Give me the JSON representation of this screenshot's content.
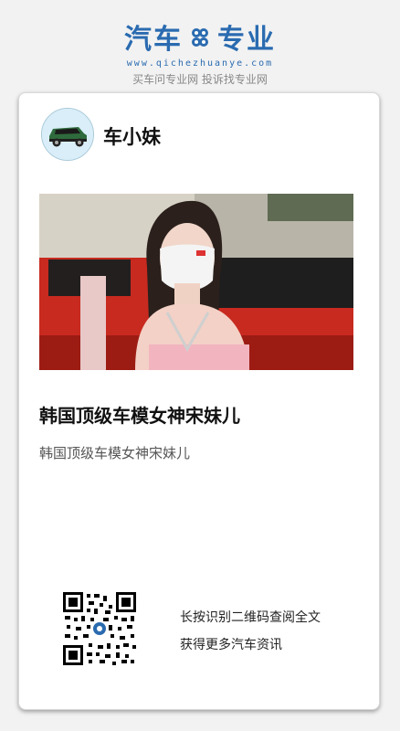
{
  "header": {
    "logo_left": "汽车",
    "logo_right": "专业",
    "logo_icon": "gear-icon",
    "url": "www.qichezhuanye.com",
    "slogan": "买车问专业网 投诉找专业网",
    "brand_color": "#2a6bb0"
  },
  "card": {
    "author": "车小妹",
    "avatar_icon": "car-icon",
    "image_alt": "hero-photo",
    "title": "韩国顶级车模女神宋妹儿",
    "summary": "韩国顶级车模女神宋妹儿",
    "qr_icon": "qr-code-icon",
    "qr_line1": "长按识别二维码查阅全文",
    "qr_line2": "获得更多汽车资讯"
  }
}
